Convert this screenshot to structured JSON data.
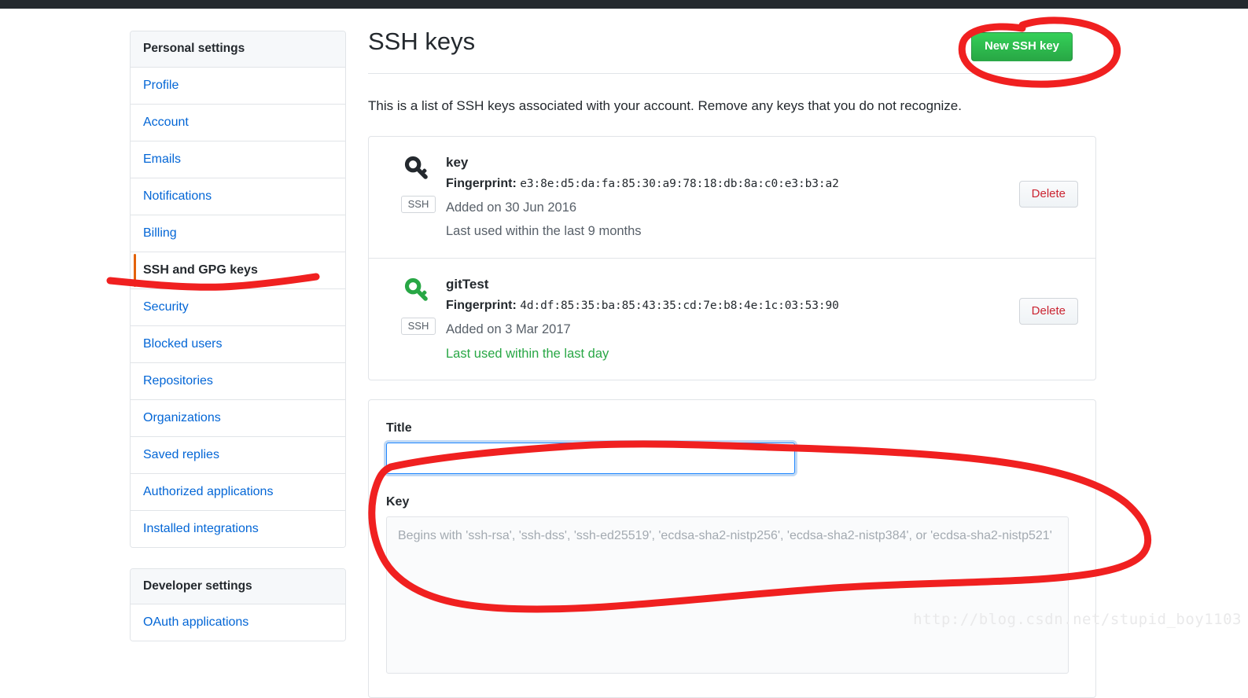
{
  "window": {
    "topbar_color": "#24292e",
    "accent_blue": "#0366d6",
    "accent_green": "#28a745",
    "danger_red": "#cb2431",
    "annotation_color": "#f02020"
  },
  "sidebar": {
    "personal": {
      "heading": "Personal settings",
      "items": [
        {
          "label": "Profile",
          "selected": false
        },
        {
          "label": "Account",
          "selected": false
        },
        {
          "label": "Emails",
          "selected": false
        },
        {
          "label": "Notifications",
          "selected": false
        },
        {
          "label": "Billing",
          "selected": false
        },
        {
          "label": "SSH and GPG keys",
          "selected": true
        },
        {
          "label": "Security",
          "selected": false
        },
        {
          "label": "Blocked users",
          "selected": false
        },
        {
          "label": "Repositories",
          "selected": false
        },
        {
          "label": "Organizations",
          "selected": false
        },
        {
          "label": "Saved replies",
          "selected": false
        },
        {
          "label": "Authorized applications",
          "selected": false
        },
        {
          "label": "Installed integrations",
          "selected": false
        }
      ]
    },
    "developer": {
      "heading": "Developer settings",
      "items": [
        {
          "label": "OAuth applications",
          "selected": false
        }
      ]
    }
  },
  "main": {
    "title": "SSH keys",
    "new_key_button": "New SSH key",
    "intro": "This is a list of SSH keys associated with your account. Remove any keys that you do not recognize.",
    "keys": [
      {
        "name": "key",
        "fingerprint_label": "Fingerprint:",
        "fingerprint": "e3:8e:d5:da:fa:85:30:a9:78:18:db:8a:c0:e3:b3:a2",
        "added": "Added on 30 Jun 2016",
        "last_used": "Last used within the last 9 months",
        "last_used_highlight": false,
        "badge": "SSH",
        "icon": "key-icon",
        "icon_color": "#24292e",
        "delete_label": "Delete"
      },
      {
        "name": "gitTest",
        "fingerprint_label": "Fingerprint:",
        "fingerprint": "4d:df:85:35:ba:85:43:35:cd:7e:b8:4e:1c:03:53:90",
        "added": "Added on 3 Mar 2017",
        "last_used": "Last used within the last day",
        "last_used_highlight": true,
        "badge": "SSH",
        "icon": "key-icon",
        "icon_color": "#28a745",
        "delete_label": "Delete"
      }
    ],
    "form": {
      "title_label": "Title",
      "title_value": "",
      "title_placeholder": "",
      "key_label": "Key",
      "key_value": "",
      "key_placeholder": "Begins with 'ssh-rsa', 'ssh-dss', 'ssh-ed25519', 'ecdsa-sha2-nistp256', 'ecdsa-sha2-nistp384', or 'ecdsa-sha2-nistp521'"
    }
  },
  "watermark": "http://blog.csdn.net/stupid_boy1103"
}
